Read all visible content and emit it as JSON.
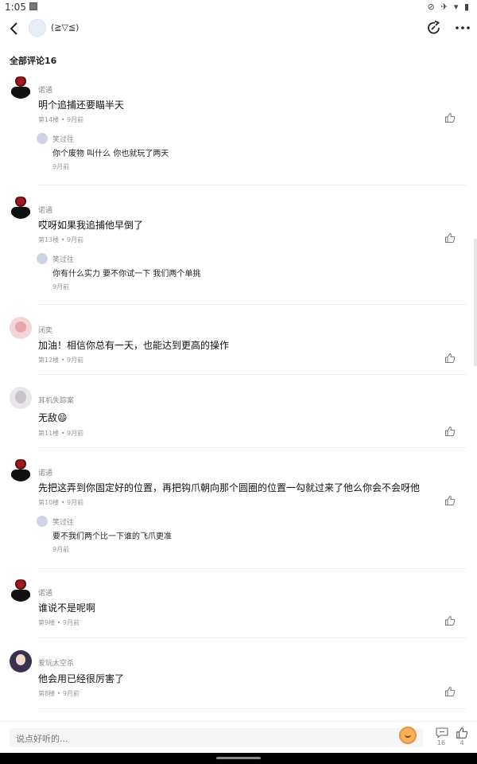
{
  "status_bar": {
    "time": "1:05",
    "icons": "⊘ ✈ ▾ ▮"
  },
  "header": {
    "title": "(≧▽≦)",
    "back_icon": "chevron-left-icon",
    "share_icon": "share-icon",
    "more_icon": "more-icon"
  },
  "section_title": "全部评论16",
  "comments": [
    {
      "name": "诺通",
      "text": "明个追捕还要瞄半天",
      "meta": "第14楼 • 9月前",
      "reply": {
        "name": "笑过往",
        "text": "你个废物 叫什么 你也就玩了两天",
        "meta": "9月前"
      }
    },
    {
      "name": "诺通",
      "text": "哎呀如果我追捕他早倒了",
      "meta": "第13楼 • 9月前",
      "reply": {
        "name": "笑过往",
        "text": "你有什么实力 要不你试一下 我们两个单挑",
        "meta": "9月前"
      }
    },
    {
      "name": "闭奕",
      "text": "加油！相信你总有一天，也能达到更高的操作",
      "meta": "第12楼 • 9月前"
    },
    {
      "name": "耳机失踪案",
      "text": "无敌😄",
      "meta": "第11楼 • 9月前"
    },
    {
      "name": "诺通",
      "text": "先把这弄到你固定好的位置，再把钩爪朝向那个圆圈的位置一勾就过来了他么你会不会呀他",
      "meta": "第10楼 • 9月前",
      "reply": {
        "name": "笑过往",
        "text": "要不我们两个比一下谁的飞爪更准",
        "meta": "9月前"
      }
    },
    {
      "name": "诺通",
      "text": "谁说不是呢啊",
      "meta": "第9楼 • 9月前"
    },
    {
      "name": "爱玩太空杀",
      "text": "他会用已经很厉害了",
      "meta": "第8楼 • 9月前"
    }
  ],
  "bottom_bar": {
    "placeholder": "说点好听的...",
    "comment_count": "16",
    "like_count": "4"
  }
}
